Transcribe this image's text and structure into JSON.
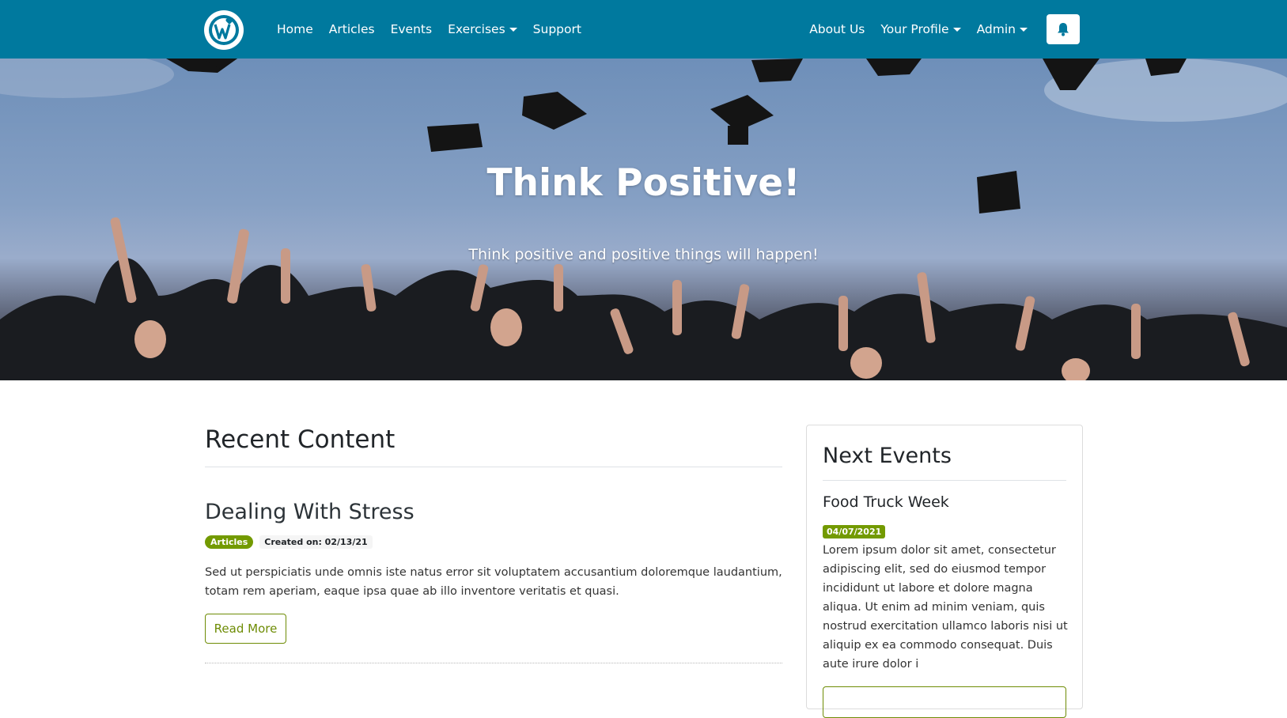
{
  "nav": {
    "left_items": [
      "Home",
      "Articles",
      "Events",
      "Exercises",
      "Support"
    ],
    "right_items": [
      "About Us",
      "Your Profile",
      "Admin"
    ],
    "bell_label": "",
    "colors": {
      "bar": "#00799e",
      "accent": "#739a00"
    }
  },
  "hero": {
    "title": "Think Positive!",
    "subtitle": "Think positive and positive things will happen!"
  },
  "recent": {
    "heading": "Recent Content",
    "post": {
      "title": "Dealing With Stress",
      "category": "Articles",
      "created": "Created on: 02/13/21",
      "excerpt": "Sed ut perspiciatis unde omnis iste natus error sit voluptatem accusantium doloremque laudantium, totam rem aperiam, eaque ipsa quae ab illo inventore veritatis et quasi.",
      "read_more": "Read More"
    }
  },
  "events": {
    "heading": "Next Events",
    "item": {
      "title": "Food Truck Week",
      "date": "04/07/2021",
      "description": "Lorem ipsum dolor sit amet, consectetur adipiscing elit, sed do eiusmod tempor incididunt ut labore et dolore magna aliqua. Ut enim ad minim veniam, quis nostrud exercitation ullamco laboris nisi ut aliquip ex ea commodo consequat. Duis aute irure dolor i"
    }
  }
}
